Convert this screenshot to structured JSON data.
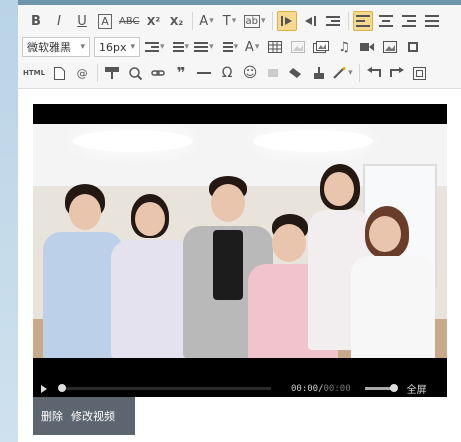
{
  "toolbar": {
    "font_family": "微软雅黑",
    "font_size": "16px"
  },
  "video": {
    "time_current": "00:00",
    "time_total": "00:00",
    "fullscreen_label": "全屏"
  },
  "actions": {
    "delete_label": "删除",
    "edit_label": "修改视频"
  },
  "colors": {
    "active_button": "#f6d98f",
    "video_bar": "#5d6670"
  }
}
